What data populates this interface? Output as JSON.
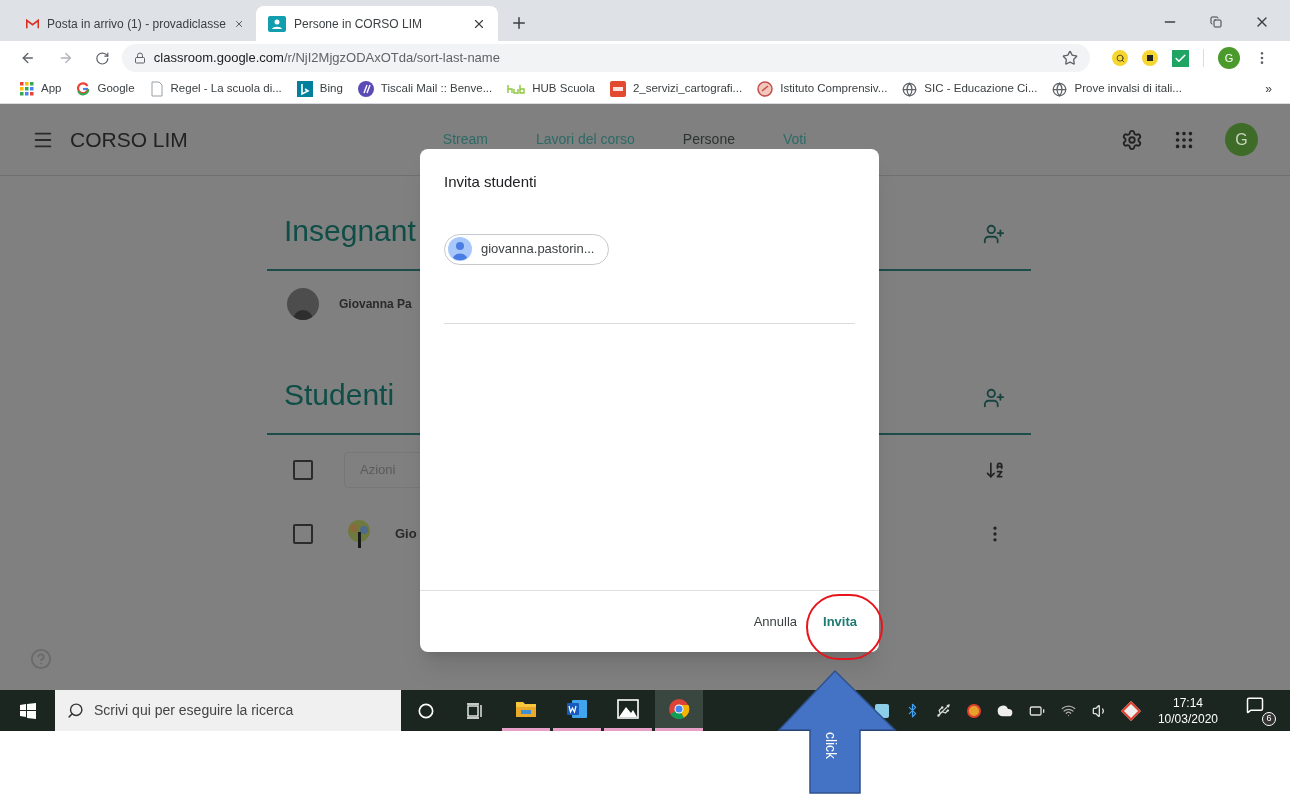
{
  "browser": {
    "tabs": [
      {
        "title": "Posta in arrivo (1) - provadiclasse",
        "kind": "mail",
        "selected": false
      },
      {
        "title": "Persone in CORSO LIM",
        "kind": "classroom",
        "selected": true
      }
    ],
    "url_domain": "classroom.google.com",
    "url_path": "/r/NjI2MjgzODAxOTda/sort-last-name",
    "profile_initial": "G",
    "bookmarks": [
      {
        "label": "App",
        "kind": "apps"
      },
      {
        "label": "Google",
        "kind": "google"
      },
      {
        "label": "Regel - La scuola di...",
        "kind": "page"
      },
      {
        "label": "Bing",
        "kind": "bing"
      },
      {
        "label": "Tiscali Mail :: Benve...",
        "kind": "tiscali"
      },
      {
        "label": "HUB Scuola",
        "kind": "hub"
      },
      {
        "label": "2_servizi_cartografi...",
        "kind": "pdf"
      },
      {
        "label": "Istituto Comprensiv...",
        "kind": "school"
      },
      {
        "label": "SIC - Educazione Ci...",
        "kind": "globe"
      },
      {
        "label": "Prove invalsi di itali...",
        "kind": "globe"
      }
    ],
    "bookmarks_more": "»"
  },
  "classroom": {
    "title": "CORSO LIM",
    "nav": [
      {
        "label": "Stream",
        "selected": false
      },
      {
        "label": "Lavori del corso",
        "selected": false
      },
      {
        "label": "Persone",
        "selected": true
      },
      {
        "label": "Voti",
        "selected": false
      }
    ],
    "avatar_initial": "G",
    "teachers": {
      "heading": "Insegnant",
      "people": [
        {
          "name": "Giovanna Pa"
        }
      ]
    },
    "students": {
      "heading": "Studenti",
      "select_all_checked": false,
      "actions": "Azioni",
      "people": [
        {
          "name": "Gio",
          "checked": false
        }
      ]
    }
  },
  "dialog": {
    "title": "Invita studenti",
    "chips": [
      "giovanna.pastorin..."
    ],
    "buttons": [
      {
        "label": "Annulla",
        "primary": false
      },
      {
        "label": "Invita",
        "primary": true
      }
    ]
  },
  "annotation": {
    "label": "click"
  },
  "taskbar": {
    "search_placeholder": "Scrivi qui per eseguire la ricerca",
    "apps": [
      {
        "kind": "explorer"
      },
      {
        "kind": "word"
      },
      {
        "kind": "photos"
      },
      {
        "kind": "chrome"
      }
    ],
    "time": "17:14",
    "date": "10/03/2020",
    "notifications": "6"
  }
}
